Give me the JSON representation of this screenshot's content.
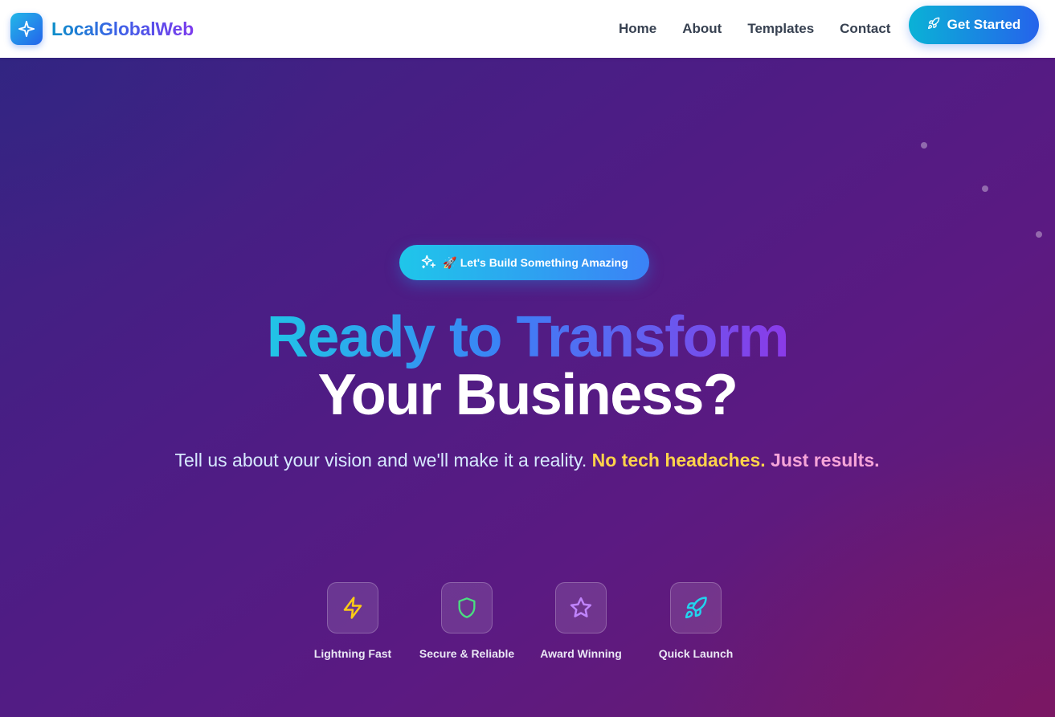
{
  "header": {
    "brand_name": "LocalGlobalWeb",
    "nav": [
      "Home",
      "About",
      "Templates",
      "Contact"
    ],
    "cta_label": "Get Started"
  },
  "hero": {
    "badge_text": "🚀 Let's Build Something Amazing",
    "headline_line1": "Ready to Transform",
    "headline_line2": "Your Business?",
    "subtitle_plain": "Tell us about your vision and we'll make it a reality. ",
    "subtitle_highlight_yellow": "No tech headaches.",
    "subtitle_highlight_pink": " Just results.",
    "features": [
      {
        "label": "Lightning Fast",
        "icon": "lightning-icon",
        "color": "#facc15"
      },
      {
        "label": "Secure & Reliable",
        "icon": "shield-icon",
        "color": "#4ade80"
      },
      {
        "label": "Award Winning",
        "icon": "star-icon",
        "color": "#c084fc"
      },
      {
        "label": "Quick Launch",
        "icon": "rocket-icon",
        "color": "#22d3ee"
      }
    ]
  },
  "colors": {
    "brand_gradient_start": "#0e8fc9",
    "brand_gradient_end": "#7c3aed",
    "cta_gradient_start": "#0ab2d6",
    "cta_gradient_end": "#2563eb",
    "hero_bg": "#4c1d85"
  }
}
